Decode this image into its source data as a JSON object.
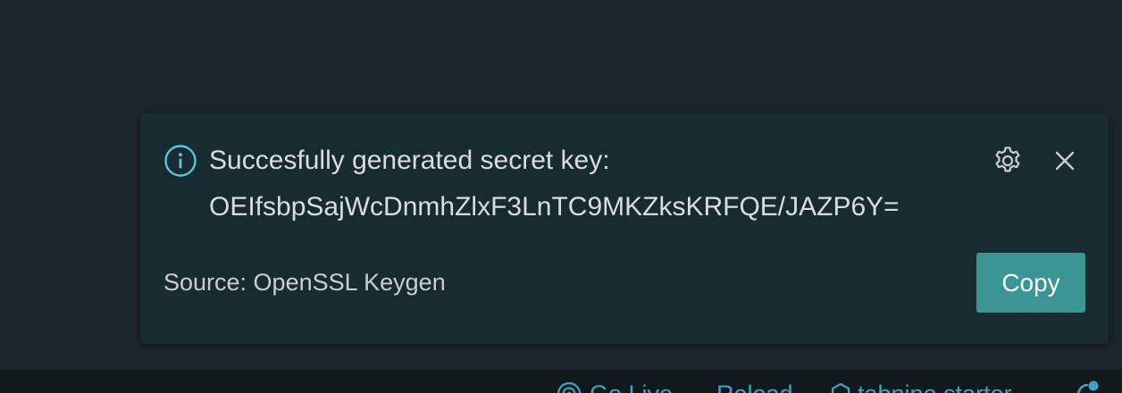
{
  "notification": {
    "message_line1": "Succesfully generated secret key:",
    "message_line2": "OEIfsbpSajWcDnmhZlxF3LnTC9MKZksKRFQE/JAZP6Y=",
    "source": "Source: OpenSSL Keygen",
    "copy_label": "Copy",
    "icons": {
      "info": "info-icon",
      "settings": "gear-icon",
      "close": "close-icon"
    }
  },
  "status_bar": {
    "go_live": "Go Live",
    "reload": "Reload",
    "tabnine": "tabnine starter"
  },
  "colors": {
    "background": "#1b262c",
    "toast_background": "#172b31",
    "accent": "#3b9595",
    "status_text": "#3da5c4",
    "info_icon": "#5cc6da"
  }
}
